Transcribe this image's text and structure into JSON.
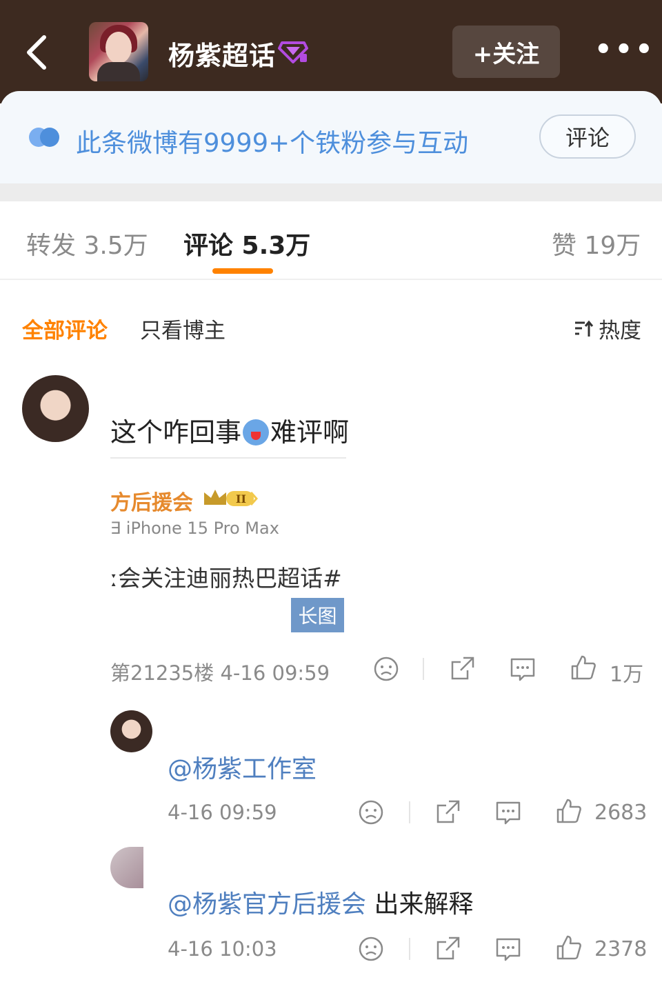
{
  "header": {
    "topic_title": "杨紫超话",
    "follow_label": "+关注",
    "more_label": "•••"
  },
  "banner": {
    "text": "此条微博有9999+个铁粉参与互动",
    "button_label": "评论",
    "accent_color": "#4e8fdc"
  },
  "tabs": [
    {
      "label": "转发 3.5万"
    },
    {
      "label": "评论 5.3万"
    },
    {
      "label": "赞 19万"
    }
  ],
  "filter": {
    "all_label": "全部评论",
    "blogger_label": "只看博主",
    "sort_label": "热度",
    "active_color": "#ff8200"
  },
  "comment": {
    "text_before": "这个咋回事",
    "text_after": "难评啊",
    "quoted_name": "方后援会",
    "quoted_badge": "II",
    "quoted_device": "∃ iPhone 15 Pro Max",
    "quoted_text": "ː会关注迪丽热巴超话#",
    "long_image_label": "长图",
    "meta": "第21235楼 4-16 09:59",
    "like_count": "1万"
  },
  "replies": [
    {
      "mention": "@杨紫工作室",
      "rest": "",
      "time": "4-16 09:59",
      "like_count": "2683"
    },
    {
      "mention": "@杨紫官方后援会",
      "rest": " 出来解释",
      "time": "4-16 10:03",
      "like_count": "2378"
    }
  ]
}
